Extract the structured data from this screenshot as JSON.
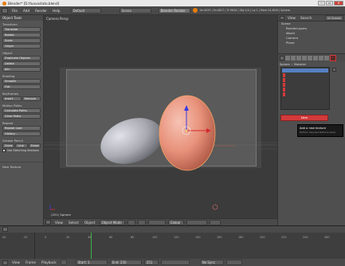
{
  "window": {
    "title": "Blender* [D:\\fuovostato.blend]",
    "buttons": [
      "–",
      "▭",
      "✕"
    ]
  },
  "info_header": {
    "menus": [
      "File",
      "Add",
      "Render",
      "Help"
    ],
    "layout": "Default",
    "scene": "Scene",
    "engine": "Blender Render",
    "stats": "Ve:4929 | Fa:4817 | Tr:9634 | Obj:1/4 | La:1 | Mem:14.81M | Sphere"
  },
  "tool_shelf": {
    "header": "Object Tools",
    "sections": [
      {
        "title": "Transform",
        "buttons": [
          "Translate",
          "Rotate",
          "Scale",
          "Origin"
        ]
      },
      {
        "title": "Object",
        "buttons": [
          "Duplicate Objects",
          "Delete",
          "Join"
        ]
      },
      {
        "title": "Shading",
        "buttons": [
          "Smooth",
          "Flat"
        ]
      },
      {
        "title": "Keyframes",
        "row": [
          "Insert",
          "Remove"
        ]
      },
      {
        "title": "Motion Paths",
        "buttons": [
          "Calculate Paths",
          "Clear Paths"
        ]
      },
      {
        "title": "Repeat",
        "buttons": [
          "Repeat Last",
          "History..."
        ]
      },
      {
        "title": "Grease Pencil",
        "row": [
          "Draw",
          "Line",
          "Erase"
        ],
        "buttons": [
          "Use Sketching Sessions"
        ]
      }
    ],
    "footer": "New Texture"
  },
  "viewport": {
    "header": "Camera Persp",
    "object_label": "(251) Sphere",
    "bottom_bar": {
      "menus": [
        "View",
        "Select",
        "Object"
      ],
      "mode": "Object Mode",
      "pivot": "Global"
    }
  },
  "outliner": {
    "header_menus": [
      "View",
      "Search"
    ],
    "filter": "All Scenes",
    "tree": [
      "Scene",
      "RenderLayers",
      "World",
      "Camera",
      "Plane"
    ]
  },
  "properties": {
    "context": [
      "Sphere",
      "Material"
    ],
    "new_button": "New",
    "tooltip_title": "Add a new texture",
    "tooltip_body": "Python: bpy.ops.texture.new()"
  },
  "timeline": {
    "menus": [
      "View",
      "Frame",
      "Playback"
    ],
    "start_label": "Start: 1",
    "end_label": "End: 250",
    "current": "251",
    "sync": "No Sync",
    "ticks": [
      "-40",
      "-20",
      "0",
      "20",
      "40",
      "60",
      "80",
      "100",
      "120",
      "140",
      "160",
      "180",
      "200",
      "220",
      "240",
      "260"
    ]
  },
  "colors": {
    "highlight": "#d33a3a",
    "selection_blue": "#5680c2",
    "egg_pink": "#e8917a",
    "egg_grey": "#a9aab2"
  }
}
